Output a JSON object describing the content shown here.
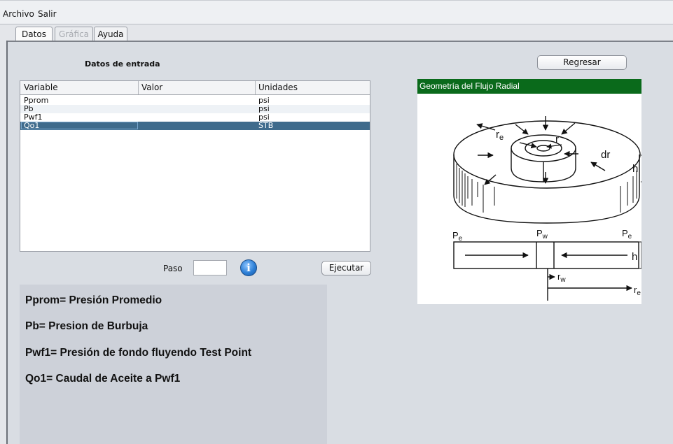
{
  "menu": {
    "items": [
      "Archivo",
      "Salir"
    ]
  },
  "tabs": [
    {
      "label": "Datos",
      "state": "active"
    },
    {
      "label": "Gráfica",
      "state": "disabled"
    },
    {
      "label": "Ayuda",
      "state": "normal"
    }
  ],
  "input_section": {
    "title": "Datos de entrada"
  },
  "table": {
    "headers": [
      "Variable",
      "Valor",
      "Unidades"
    ],
    "rows": [
      {
        "variable": "Pprom",
        "valor": "",
        "unidades": "psi"
      },
      {
        "variable": "Pb",
        "valor": "",
        "unidades": "psi"
      },
      {
        "variable": "Pwf1",
        "valor": "",
        "unidades": "psi"
      },
      {
        "variable": "Qo1",
        "valor": "",
        "unidades": "STB"
      }
    ],
    "selected_row": 3
  },
  "controls": {
    "paso_label": "Paso",
    "paso_value": "",
    "ejecutar_label": "Ejecutar",
    "regresar_label": "Regresar",
    "info_icon": "info-icon"
  },
  "legend": {
    "lines": [
      "Pprom= Presión Promedio",
      "Pb= Presion de Burbuja",
      "Pwf1= Presión de fondo fluyendo Test Point",
      "Qo1= Caudal de Aceite a Pwf1"
    ]
  },
  "figure": {
    "header": "Geometría del Flujo Radial",
    "labels": {
      "re": "r",
      "re_sub": "e",
      "r": "r",
      "dr": "dr",
      "h": "h",
      "pe_left": "P",
      "pe_left_sub": "e",
      "pw": "P",
      "pw_sub": "w",
      "pe_right": "P",
      "pe_right_sub": "e",
      "h2": "h",
      "rw": "r",
      "rw_sub": "w",
      "re2": "r",
      "re2_sub": "e"
    },
    "header_color": "#0a6a1b"
  },
  "colors": {
    "selected_row": "#3f6b8c",
    "background": "#d9dde3",
    "legend_panel": "#cdd1d9"
  }
}
